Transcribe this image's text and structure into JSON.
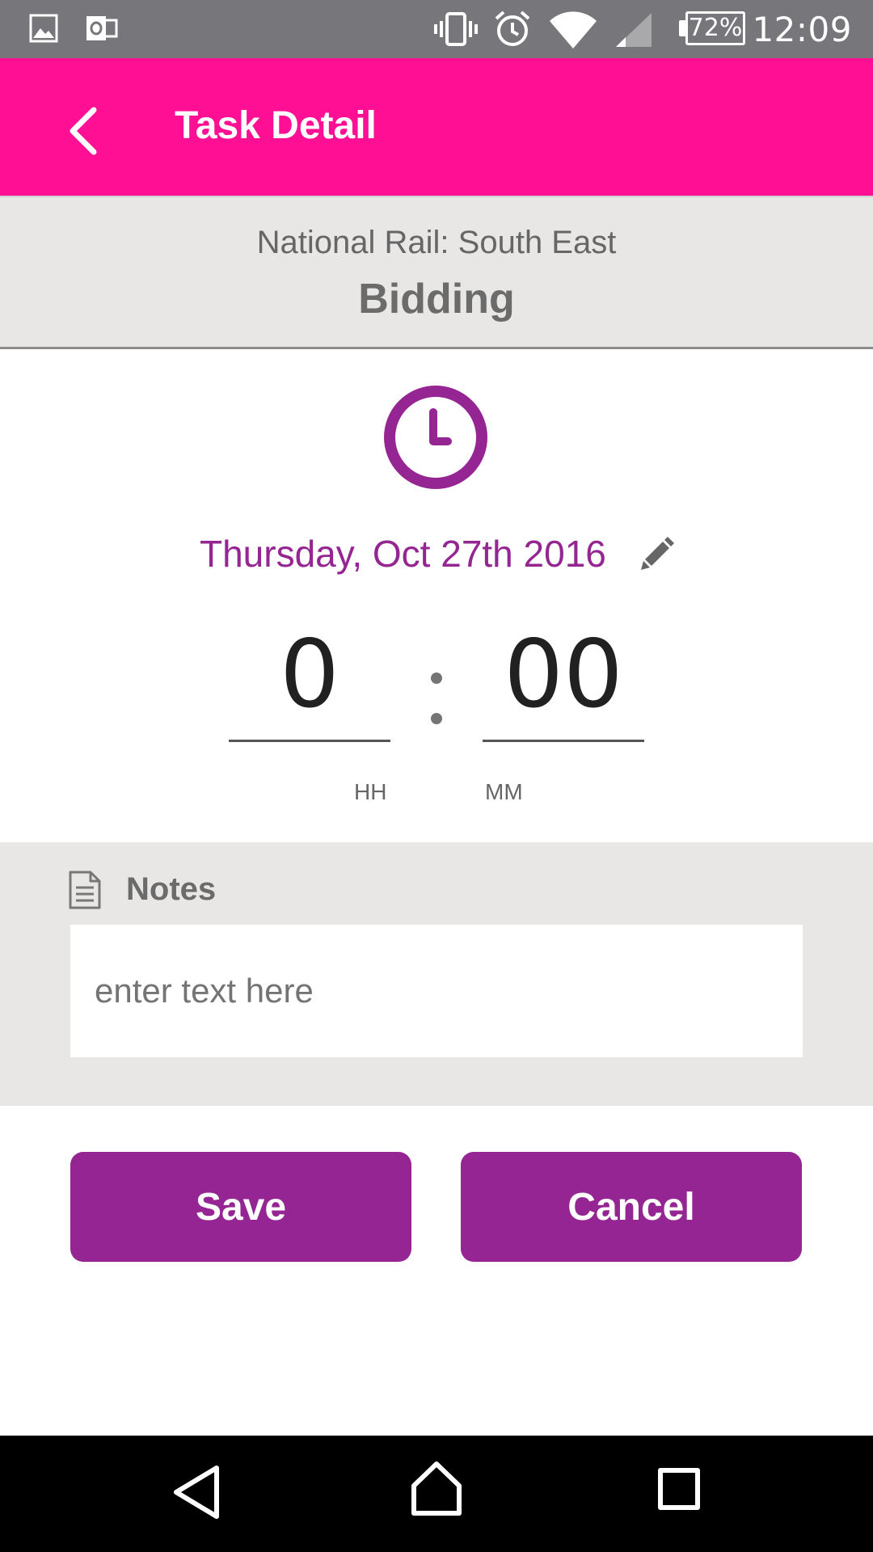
{
  "status_bar": {
    "battery": "72%",
    "time": "12:09"
  },
  "app_bar": {
    "title": "Task Detail"
  },
  "header": {
    "company": "National Rail: South East",
    "task": "Bidding"
  },
  "schedule": {
    "date": "Thursday, Oct 27th 2016",
    "hours": "0",
    "minutes": "00",
    "hours_label": "HH",
    "minutes_label": "MM"
  },
  "notes": {
    "label": "Notes",
    "placeholder": "enter text here",
    "value": ""
  },
  "actions": {
    "save_label": "Save",
    "cancel_label": "Cancel"
  },
  "colors": {
    "app_bar": "#fe0f93",
    "accent": "#952592",
    "panel": "#e8e7e6"
  }
}
